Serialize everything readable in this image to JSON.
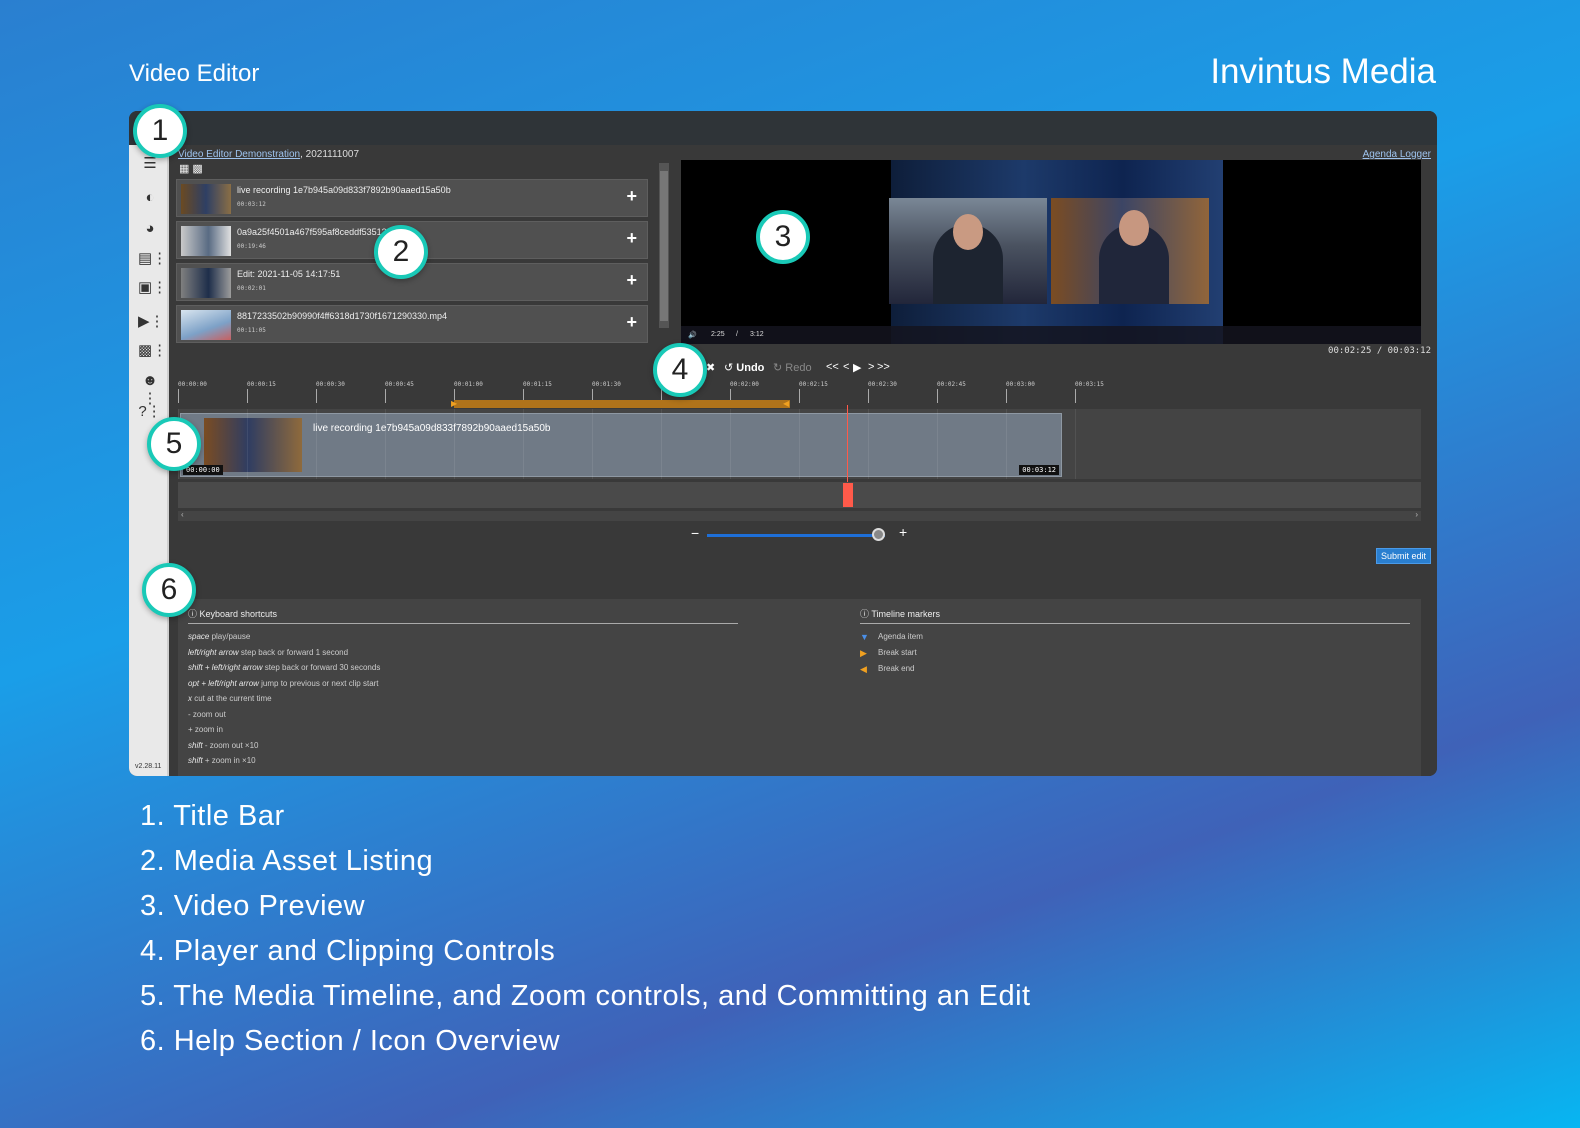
{
  "page_title": "Video Editor",
  "brand": "Invintus Media",
  "app": {
    "breadcrumb_link": "Video Editor Demonstration",
    "breadcrumb_rest": ", 2021111007",
    "agenda_link": "Agenda Logger",
    "version": "v2.28.11",
    "sidebar_icons": [
      "menu-icon",
      "dashboard-icon",
      "pie-chart-icon",
      "list-icon",
      "media-library-icon",
      "add-video-icon",
      "toolbox-icon",
      "users-settings-icon",
      "help-icon"
    ],
    "assets": [
      {
        "name": "live recording 1e7b945a09d833f7892b90aaed15a50b",
        "duration": "00:03:12"
      },
      {
        "name": "0a9a25f4501a467f595af8ceddf53513...mp4",
        "duration": "00:19:46"
      },
      {
        "name": "Edit: 2021-11-05 14:17:51",
        "duration": "00:02:01"
      },
      {
        "name": "8817233502b90990f4ff6318d1730f1671290330.mp4",
        "duration": "00:11:05"
      }
    ],
    "player": {
      "current": "2:25",
      "separator": "/",
      "total": "3:12"
    },
    "timecode": "00:02:25 / 00:03:12",
    "controls": {
      "undo": "Undo",
      "redo": "Redo",
      "back_fast": "<<",
      "back": "<",
      "forward": ">",
      "forward_fast": ">>"
    },
    "ruler_ticks": [
      "00:00:00",
      "00:00:15",
      "00:00:30",
      "00:00:45",
      "00:01:00",
      "00:01:15",
      "00:01:30",
      "00:01:45",
      "00:02:00",
      "00:02:15",
      "00:02:30",
      "00:02:45",
      "00:03:00",
      "00:03:15"
    ],
    "clip": {
      "name": "live recording 1e7b945a09d833f7892b90aaed15a50b",
      "start": "00:00:00",
      "end": "00:03:12"
    },
    "zoom": {
      "minus": "−",
      "plus": "+",
      "level": 0.96
    },
    "submit": "Submit edit",
    "help": {
      "shortcuts_title": "Keyboard shortcuts",
      "shortcuts": [
        {
          "key": "space",
          "desc": " play/pause"
        },
        {
          "key": "left/right arrow",
          "desc": " step back or forward 1 second"
        },
        {
          "key": "shift + left/right arrow",
          "desc": " step back or forward 30 seconds"
        },
        {
          "key": "opt + left/right arrow",
          "desc": " jump to previous or next clip start"
        },
        {
          "key": "x",
          "desc": " cut at the current time"
        },
        {
          "key": "",
          "desc": "- zoom out"
        },
        {
          "key": "",
          "desc": "+ zoom in"
        },
        {
          "key": "shift",
          "desc": " - zoom out ×10"
        },
        {
          "key": "shift",
          "desc": " + zoom in ×10"
        }
      ],
      "markers_title": "Timeline markers",
      "markers": [
        {
          "label": "Agenda item",
          "color": "#4a8fe8"
        },
        {
          "label": "Break start",
          "color": "#f0a020"
        },
        {
          "label": "Break end",
          "color": "#f0a020"
        }
      ]
    }
  },
  "badges": [
    "1",
    "2",
    "3",
    "4",
    "5",
    "6"
  ],
  "legend": [
    "1. Title Bar",
    "2. Media Asset Listing",
    "3. Video Preview",
    "4. Player and Clipping Controls",
    "5. The Media Timeline, and Zoom controls, and Committing an Edit",
    "6. Help Section / Icon Overview"
  ],
  "colors": {
    "badge_ring": "#19c9b7",
    "accent": "#2a7fd0",
    "playhead": "#ff5a4a"
  }
}
